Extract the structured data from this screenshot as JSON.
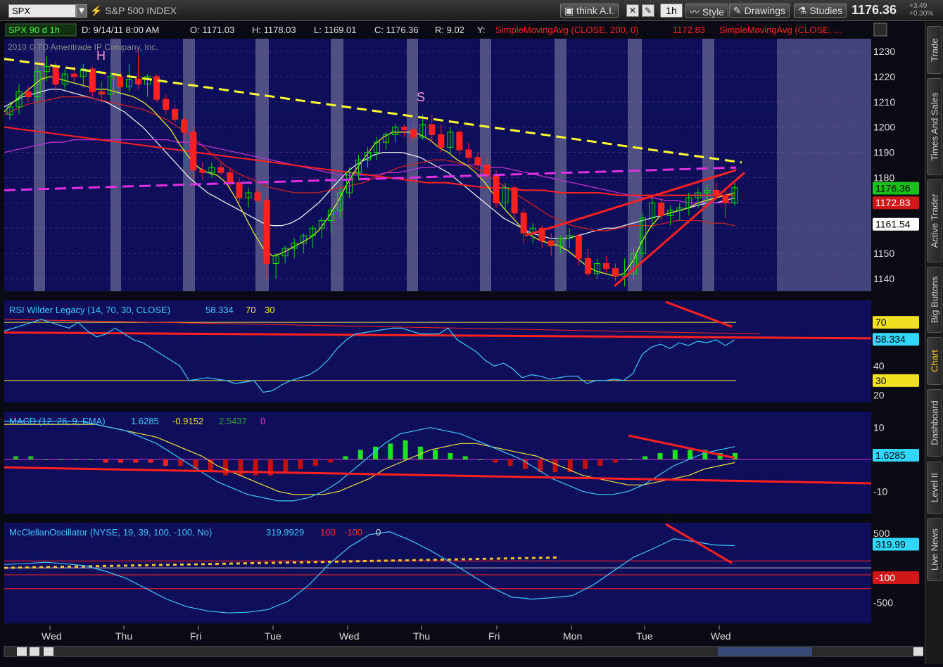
{
  "toolbar": {
    "symbol": "SPX",
    "symbol_name": "S&P 500 INDEX",
    "think_ai": "think A.I.",
    "timeframe": "1h",
    "style": "Style",
    "drawings": "Drawings",
    "studies": "Studies",
    "last_price": "1176.36",
    "change": "+3.49",
    "change_pct": "+0.30%"
  },
  "header": {
    "symbol_period": "SPX 90 d 1h",
    "date": "D: 9/14/11 8:00 AM",
    "open": "O: 1171.03",
    "high": "H: 1178.03",
    "low": "L: 1169.01",
    "close": "C: 1176.36",
    "range": "R: 9.02",
    "y": "Y:",
    "sma200": "SimpleMovingAvg (CLOSE, 200, 0)",
    "sma200_value": "1172.83",
    "sma_other": "SimpleMovingAvg (CLOSE, ...",
    "copyright": "2010 © TD Ameritrade IP Company, Inc."
  },
  "annotations": {
    "head": "H",
    "shoulder": "S"
  },
  "price_scale": {
    "ticks": [
      "1230",
      "1220",
      "1210",
      "1200",
      "1190",
      "1180",
      "1170",
      "1150",
      "1140"
    ],
    "tag_last": "1176.36",
    "tag_sma": "1172.83",
    "tag_lower": "1161.54"
  },
  "rsi": {
    "title": "RSI Wilder Legacy (14, 70, 30, CLOSE)",
    "value": "58.334",
    "ob": "70",
    "os": "30",
    "ticks": [
      "40",
      "20"
    ],
    "tag_ob": "70",
    "tag_value": "58.334",
    "tag_os": "30"
  },
  "macd": {
    "title": "MACD (12, 26, 9, EMA)",
    "value": "1.6285",
    "avg": "-0.9152",
    "diff": "2.5437",
    "zero": "0",
    "ticks": [
      "10",
      "0",
      "-10"
    ],
    "tag_value": "1.6285"
  },
  "mcclellan": {
    "title": "McClellanOscillator (NYSE, 19, 39, 100, -100, No)",
    "value": "319.9929",
    "ob": "100",
    "os": "-100",
    "zero": "0",
    "ticks": [
      "500",
      "0",
      "-500"
    ],
    "tag_value": "319.99",
    "tag_os": "-100"
  },
  "time_axis": [
    "Wed",
    "Thu",
    "Fri",
    "Tue",
    "Wed",
    "Thu",
    "Fri",
    "Mon",
    "Tue",
    "Wed"
  ],
  "sidebar": [
    "Trade",
    "Times And Sales",
    "Active Trader",
    "Big Buttons",
    "Chart",
    "Dashboard",
    "Level II",
    "Live News"
  ],
  "colors": {
    "up": "#00e000",
    "down": "#ff2020",
    "plot_bg": "#0e0e5a",
    "session_band": "#5a5a8c",
    "yellow_trend": "#ffff30",
    "magenta_trend": "#e030e0",
    "red_trend": "#ff2020",
    "cyan": "#40c8ff"
  },
  "chart_data": {
    "type": "candlestick",
    "price": {
      "ylim": [
        1135,
        1235
      ],
      "candles": [
        [
          1205,
          1210,
          1203,
          1208
        ],
        [
          1208,
          1217,
          1205,
          1214
        ],
        [
          1214,
          1216,
          1210,
          1212
        ],
        [
          1212,
          1224,
          1210,
          1222
        ],
        [
          1222,
          1228,
          1218,
          1224
        ],
        [
          1224,
          1226,
          1214,
          1217
        ],
        [
          1217,
          1223,
          1215,
          1221
        ],
        [
          1221,
          1224,
          1218,
          1220
        ],
        [
          1220,
          1225,
          1216,
          1223
        ],
        [
          1223,
          1224,
          1212,
          1214
        ],
        [
          1214,
          1218,
          1210,
          1213
        ],
        [
          1213,
          1222,
          1211,
          1220
        ],
        [
          1220,
          1222,
          1214,
          1216
        ],
        [
          1216,
          1225,
          1214,
          1219
        ],
        [
          1219,
          1230,
          1215,
          1217
        ],
        [
          1217,
          1221,
          1212,
          1220
        ],
        [
          1220,
          1221,
          1210,
          1211
        ],
        [
          1211,
          1213,
          1205,
          1207
        ],
        [
          1207,
          1209,
          1202,
          1203
        ],
        [
          1203,
          1205,
          1195,
          1198
        ],
        [
          1198,
          1200,
          1180,
          1183
        ],
        [
          1183,
          1186,
          1179,
          1182
        ],
        [
          1182,
          1186,
          1180,
          1184
        ],
        [
          1184,
          1186,
          1181,
          1182
        ],
        [
          1182,
          1184,
          1176,
          1178
        ],
        [
          1178,
          1180,
          1170,
          1172
        ],
        [
          1172,
          1176,
          1168,
          1174
        ],
        [
          1174,
          1176,
          1170,
          1171
        ],
        [
          1171,
          1173,
          1140,
          1146
        ],
        [
          1146,
          1150,
          1140,
          1149
        ],
        [
          1149,
          1153,
          1146,
          1152
        ],
        [
          1152,
          1156,
          1148,
          1154
        ],
        [
          1154,
          1158,
          1150,
          1157
        ],
        [
          1157,
          1161,
          1152,
          1160
        ],
        [
          1160,
          1164,
          1156,
          1163
        ],
        [
          1163,
          1168,
          1158,
          1167
        ],
        [
          1167,
          1176,
          1164,
          1174
        ],
        [
          1174,
          1184,
          1172,
          1182
        ],
        [
          1182,
          1189,
          1179,
          1187
        ],
        [
          1187,
          1192,
          1184,
          1190
        ],
        [
          1190,
          1196,
          1187,
          1194
        ],
        [
          1194,
          1198,
          1191,
          1197
        ],
        [
          1197,
          1201,
          1194,
          1200
        ],
        [
          1200,
          1201,
          1196,
          1199
        ],
        [
          1199,
          1203,
          1194,
          1196
        ],
        [
          1196,
          1205,
          1195,
          1201
        ],
        [
          1201,
          1205,
          1194,
          1197
        ],
        [
          1197,
          1201,
          1190,
          1192
        ],
        [
          1192,
          1200,
          1189,
          1198
        ],
        [
          1198,
          1199,
          1189,
          1191
        ],
        [
          1191,
          1194,
          1186,
          1188
        ],
        [
          1188,
          1190,
          1184,
          1185
        ],
        [
          1185,
          1188,
          1179,
          1181
        ],
        [
          1181,
          1183,
          1168,
          1170
        ],
        [
          1170,
          1178,
          1167,
          1176
        ],
        [
          1176,
          1177,
          1164,
          1166
        ],
        [
          1166,
          1168,
          1154,
          1158
        ],
        [
          1158,
          1162,
          1154,
          1160
        ],
        [
          1160,
          1161,
          1152,
          1155
        ],
        [
          1155,
          1158,
          1149,
          1153
        ],
        [
          1153,
          1157,
          1150,
          1156
        ],
        [
          1156,
          1160,
          1152,
          1157
        ],
        [
          1157,
          1158,
          1145,
          1148
        ],
        [
          1148,
          1152,
          1141,
          1142
        ],
        [
          1142,
          1148,
          1140,
          1146
        ],
        [
          1146,
          1149,
          1142,
          1144
        ],
        [
          1144,
          1146,
          1139,
          1141
        ],
        [
          1141,
          1148,
          1137,
          1142
        ],
        [
          1142,
          1152,
          1140,
          1150
        ],
        [
          1150,
          1166,
          1148,
          1164
        ],
        [
          1164,
          1172,
          1160,
          1170
        ],
        [
          1170,
          1172,
          1163,
          1165
        ],
        [
          1165,
          1169,
          1161,
          1167
        ],
        [
          1167,
          1170,
          1163,
          1168
        ],
        [
          1168,
          1174,
          1165,
          1172
        ],
        [
          1172,
          1176,
          1168,
          1174
        ],
        [
          1174,
          1177,
          1170,
          1175
        ],
        [
          1175,
          1178,
          1171,
          1173
        ],
        [
          1173,
          1176,
          1164,
          1170
        ],
        [
          1170,
          1178,
          1169,
          1176
        ]
      ],
      "sma_fast": [
        1206,
        1210,
        1213,
        1216,
        1219,
        1220,
        1219,
        1218,
        1217,
        1216,
        1215,
        1215,
        1214,
        1213,
        1212,
        1210,
        1207,
        1203,
        1199,
        1193,
        1188,
        1184,
        1182,
        1181,
        1178,
        1172,
        1165,
        1158,
        1152,
        1149,
        1150,
        1152,
        1154,
        1156,
        1159,
        1164,
        1170,
        1177,
        1183,
        1188,
        1193,
        1196,
        1198,
        1198,
        1198,
        1197,
        1195,
        1192,
        1190,
        1187,
        1185,
        1182,
        1178,
        1173,
        1168,
        1164,
        1160,
        1157,
        1155,
        1154,
        1153,
        1151,
        1148,
        1145,
        1143,
        1142,
        1141,
        1142,
        1147,
        1155,
        1161,
        1165,
        1166,
        1167,
        1168,
        1170,
        1171,
        1172,
        1173,
        1174
      ],
      "sma_mid": [
        1208,
        1210,
        1212,
        1213,
        1214,
        1215,
        1215,
        1214,
        1213,
        1212,
        1211,
        1210,
        1208,
        1206,
        1203,
        1200,
        1196,
        1192,
        1188,
        1184,
        1180,
        1177,
        1174,
        1172,
        1170,
        1168,
        1166,
        1164,
        1162,
        1161,
        1161,
        1162,
        1164,
        1167,
        1170,
        1174,
        1178,
        1182,
        1185,
        1187,
        1189,
        1190,
        1190,
        1190,
        1189,
        1188,
        1186,
        1184,
        1182,
        1179,
        1176,
        1173,
        1170,
        1167,
        1164,
        1162,
        1160,
        1158,
        1157,
        1156,
        1156,
        1156,
        1157,
        1158,
        1159,
        1160,
        1160,
        1161,
        1162,
        1163,
        1164,
        1165,
        1166,
        1167,
        1168,
        1169,
        1170,
        1170,
        1171,
        1172
      ],
      "sma_slow": [
        1205,
        1207,
        1209,
        1210,
        1211,
        1212,
        1212,
        1212,
        1211,
        1210,
        1209,
        1208,
        1207,
        1205,
        1203,
        1200,
        1197,
        1193,
        1189,
        1185,
        1182,
        1180,
        1178,
        1176,
        1175,
        1174,
        1174,
        1174,
        1175,
        1176,
        1177,
        1178,
        1180,
        1182,
        1184,
        1185,
        1186,
        1187,
        1187,
        1186,
        1185,
        1183,
        1180,
        1177,
        1174,
        1171,
        1168,
        1165,
        1163,
        1161,
        1160,
        1159,
        1159,
        1160,
        1161,
        1161,
        1161,
        1162,
        1163,
        1163,
        1163,
        1162,
        1162,
        1161
      ],
      "sma_magenta": [
        1190,
        1191,
        1192,
        1193,
        1194,
        1194,
        1195,
        1195,
        1195,
        1195,
        1195,
        1195,
        1195,
        1195,
        1195,
        1194,
        1194,
        1193,
        1192,
        1191,
        1190,
        1189,
        1188,
        1187,
        1186,
        1185,
        1184,
        1183,
        1182,
        1181,
        1181,
        1181,
        1181,
        1182,
        1182,
        1183,
        1184,
        1184,
        1185,
        1185,
        1185,
        1185,
        1184,
        1184,
        1183,
        1182,
        1181,
        1180,
        1179,
        1178,
        1177,
        1176,
        1175,
        1174,
        1173,
        1172,
        1172,
        1171,
        1171,
        1170,
        1170,
        1170,
        1170,
        1170
      ],
      "sma200": [
        1200,
        1199,
        1198,
        1197,
        1196,
        1195,
        1194,
        1193,
        1192,
        1191,
        1190,
        1189,
        1188,
        1187,
        1186,
        1185,
        1184,
        1183,
        1182,
        1181,
        1180,
        1179,
        1178,
        1178,
        1177,
        1176,
        1176,
        1175,
        1175,
        1174,
        1174,
        1174,
        1173,
        1173,
        1173,
        1173,
        1173,
        1173,
        1173
      ]
    },
    "rsi": {
      "ylim": [
        15,
        85
      ],
      "overbought": 70,
      "oversold": 30,
      "values": [
        64,
        66,
        68,
        70,
        72,
        70,
        68,
        66,
        70,
        64,
        60,
        62,
        66,
        62,
        58,
        56,
        52,
        48,
        44,
        40,
        30,
        31,
        32,
        31,
        30,
        28,
        29,
        30,
        22,
        23,
        27,
        30,
        32,
        34,
        38,
        44,
        52,
        58,
        62,
        63,
        64,
        65,
        66,
        66,
        64,
        62,
        62,
        62,
        66,
        58,
        54,
        50,
        44,
        40,
        42,
        38,
        32,
        34,
        33,
        31,
        32,
        33,
        33,
        28,
        30,
        30,
        31,
        30,
        35,
        48,
        53,
        55,
        52,
        56,
        54,
        57,
        56,
        58,
        54,
        58
      ]
    },
    "macd": {
      "ylim": [
        -17,
        15
      ],
      "values": [
        12,
        12,
        12,
        12,
        12,
        12,
        11,
        10,
        9,
        7,
        5,
        2,
        -1,
        -4,
        -7,
        -9,
        -11,
        -12,
        -13,
        -13,
        -12,
        -10,
        -7,
        -3,
        1,
        5,
        8,
        9,
        10,
        9,
        8,
        6,
        4,
        2,
        0,
        -3,
        -6,
        -8,
        -10,
        -11,
        -11,
        -10,
        -8,
        -5,
        -2,
        0,
        2,
        3,
        4
      ],
      "avg": [
        11,
        11,
        11,
        11,
        11,
        11,
        11,
        10,
        9,
        8,
        7,
        5,
        3,
        1,
        -2,
        -4,
        -6,
        -8,
        -10,
        -11,
        -11,
        -11,
        -10,
        -8,
        -6,
        -3,
        -1,
        1,
        3,
        4,
        5,
        5,
        4,
        3,
        2,
        1,
        -1,
        -3,
        -5,
        -6,
        -7,
        -8,
        -8,
        -7,
        -6,
        -5,
        -3,
        -2,
        -1
      ],
      "histogram": [
        1,
        1,
        0,
        0,
        0,
        0,
        -1,
        -1,
        -1,
        -1,
        -2,
        -2,
        -3,
        -4,
        -5,
        -5,
        -5,
        -5,
        -4,
        -3,
        -2,
        -1,
        1,
        3,
        4,
        5,
        6,
        4,
        3,
        2,
        1,
        0,
        -1,
        -2,
        -3,
        -4,
        -4,
        -4,
        -3,
        -2,
        -1,
        0,
        1,
        2,
        3,
        3,
        3,
        2,
        2
      ]
    },
    "mcclellan": {
      "ylim": [
        -800,
        650
      ],
      "overbought": 100,
      "oversold": -100,
      "values": [
        50,
        60,
        80,
        60,
        30,
        -50,
        -150,
        -300,
        -450,
        -560,
        -620,
        -650,
        -640,
        -600,
        -480,
        -250,
        50,
        300,
        480,
        520,
        400,
        250,
        80,
        -100,
        -280,
        -420,
        -450,
        -430,
        -400,
        -250,
        -50,
        150,
        280,
        420,
        380,
        330,
        320
      ]
    }
  }
}
